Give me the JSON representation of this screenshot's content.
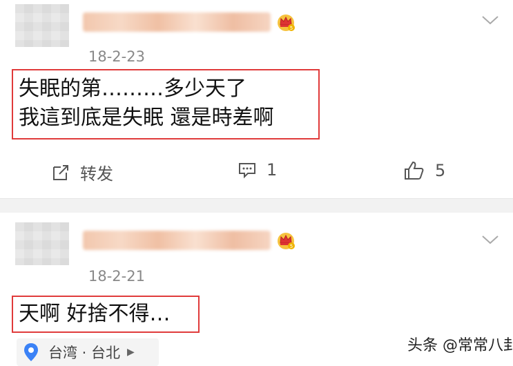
{
  "posts": [
    {
      "date": "18-2-23",
      "lines": [
        "失眠的第………多少天了",
        "我這到底是失眠 還是時差啊"
      ],
      "actions": {
        "repost_label": "转发",
        "comment_count": "1",
        "like_count": "5"
      }
    },
    {
      "date": "18-2-21",
      "lines": [
        "天啊 好捨不得…"
      ],
      "location": "台湾 · 台北"
    }
  ],
  "watermark": "头条 @常常八卦",
  "colors": {
    "highlight_border": "#e03a3a",
    "crown_gold": "#f0b400",
    "crown_red": "#d33",
    "location_pin": "#3b82f6"
  },
  "icons": [
    "avatar",
    "vip-crown-icon",
    "chevron-down-icon",
    "repost-icon",
    "comment-icon",
    "like-icon",
    "location-pin-icon",
    "chevron-right-icon"
  ]
}
